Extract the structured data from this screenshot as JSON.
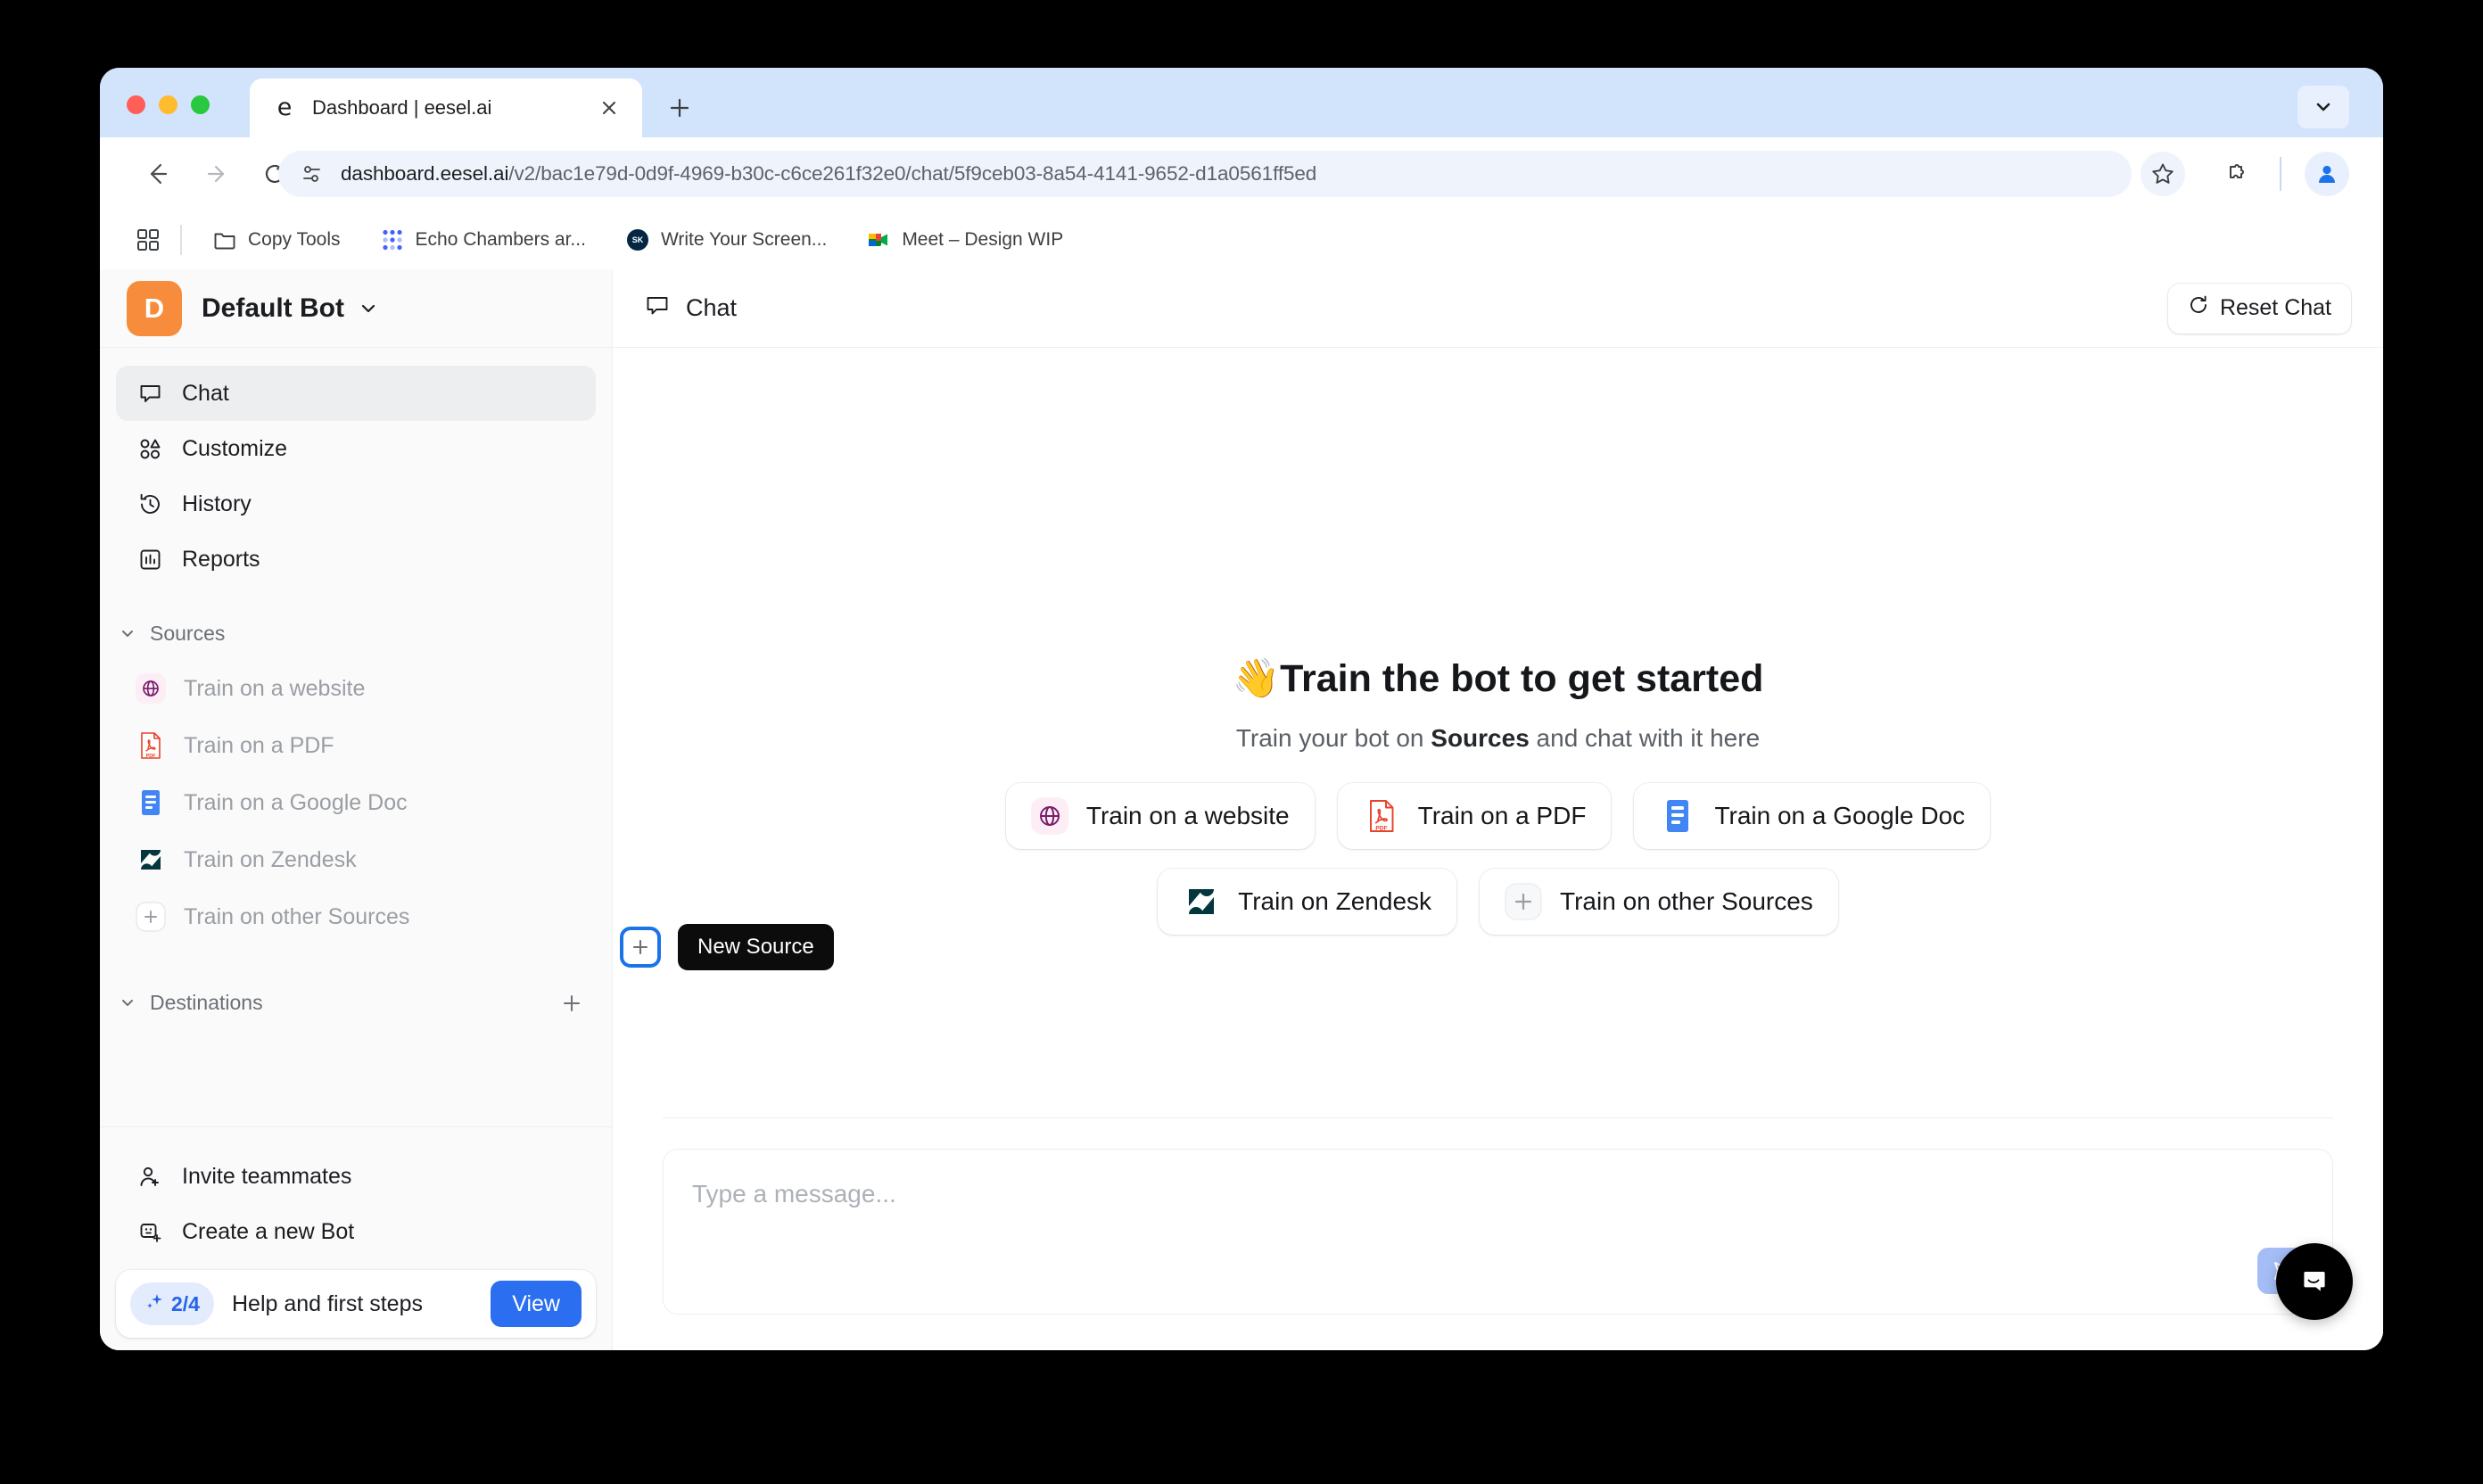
{
  "browser": {
    "tab": {
      "title": "Dashboard | eesel.ai",
      "favicon": "e",
      "close_icon": "close-icon"
    },
    "new_tab_label": "+",
    "url": "dashboard.eesel.ai/v2/bac1e79d-0d9f-4969-b30c-c6ce261f32e0/chat/5f9ceb03-8a54-4141-9652-d1a0561ff5ed",
    "url_host": "dashboard.eesel.ai",
    "url_path": "/v2/bac1e79d-0d9f-4969-b30c-c6ce261f32e0/chat/5f9ceb03-8a54-4141-9652-d1a0561ff5ed",
    "bookmarks": [
      {
        "label": "Copy Tools",
        "icon": "folder-icon"
      },
      {
        "label": "Echo Chambers ar...",
        "icon": "miro-icon"
      },
      {
        "label": "Write Your Screen...",
        "icon": "skillshare-icon"
      },
      {
        "label": "Meet – Design WIP",
        "icon": "google-meet-icon"
      }
    ]
  },
  "sidebar": {
    "bot": {
      "avatar_letter": "D",
      "name": "Default Bot",
      "avatar_color": "#f78c3c"
    },
    "nav": [
      {
        "label": "Chat",
        "icon": "chat-bubble-icon",
        "active": true
      },
      {
        "label": "Customize",
        "icon": "shapes-icon",
        "active": false
      },
      {
        "label": "History",
        "icon": "clock-rewind-icon",
        "active": false
      },
      {
        "label": "Reports",
        "icon": "bar-chart-icon",
        "active": false
      }
    ],
    "sources_section": {
      "label": "Sources",
      "add_tooltip": "New Source"
    },
    "sources": [
      {
        "label": "Train on a website",
        "icon": "globe-icon"
      },
      {
        "label": "Train on a PDF",
        "icon": "pdf-icon"
      },
      {
        "label": "Train on a Google Doc",
        "icon": "google-docs-icon"
      },
      {
        "label": "Train on Zendesk",
        "icon": "zendesk-icon"
      },
      {
        "label": "Train on other Sources",
        "icon": "plus-icon"
      }
    ],
    "destinations_section": {
      "label": "Destinations"
    },
    "bottom": [
      {
        "label": "Invite teammates",
        "icon": "user-plus-icon"
      },
      {
        "label": "Create a new Bot",
        "icon": "bot-plus-icon"
      }
    ],
    "help_card": {
      "badge": "2/4",
      "label": "Help and first steps",
      "button": "View",
      "button_color": "#2b6ef0"
    }
  },
  "main": {
    "header": {
      "title": "Chat",
      "icon": "chat-bubble-icon",
      "reset_label": "Reset Chat",
      "reset_icon": "refresh-icon"
    },
    "empty_state": {
      "emoji": "👋",
      "title": "Train the bot to get started",
      "subtitle_before": "Train your bot on ",
      "subtitle_strong": "Sources",
      "subtitle_after": " and chat with it here"
    },
    "chips_row1": [
      {
        "label": "Train on a website",
        "icon": "globe-icon"
      },
      {
        "label": "Train on a PDF",
        "icon": "pdf-icon"
      },
      {
        "label": "Train on a Google Doc",
        "icon": "google-docs-icon"
      }
    ],
    "chips_row2": [
      {
        "label": "Train on Zendesk",
        "icon": "zendesk-icon"
      },
      {
        "label": "Train on other Sources",
        "icon": "plus-icon"
      }
    ],
    "composer": {
      "placeholder": "Type a message...",
      "send_icon": "send-icon",
      "send_color": "#a5bdf7"
    },
    "intercom": {
      "icon": "intercom-messenger-icon"
    }
  }
}
